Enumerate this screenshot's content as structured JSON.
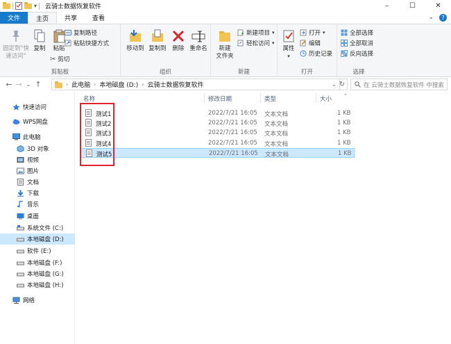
{
  "window": {
    "title": "云骑士数据恢复软件",
    "controls": [
      "–",
      "☐",
      "✕"
    ]
  },
  "tabs": [
    {
      "label": "文件"
    },
    {
      "label": "主页"
    },
    {
      "label": "共享"
    },
    {
      "label": "查看"
    }
  ],
  "ribbon": {
    "clipboard": {
      "label": "剪贴板",
      "pin": "固定到\"快\n速访问\"",
      "copy": "复制",
      "paste": "粘贴",
      "copy_path": "复制路径",
      "paste_shortcut": "粘贴快捷方式",
      "cut": "剪切"
    },
    "organize": {
      "label": "组织",
      "move_to": "移动到",
      "copy_to": "复制到",
      "delete": "删除",
      "rename": "重命名"
    },
    "new": {
      "label": "新建",
      "new_folder": "新建\n文件夹",
      "new_item": "新建项目",
      "easy_access": "轻松访问"
    },
    "open": {
      "label": "打开",
      "properties": "属性",
      "open": "打开",
      "edit": "编辑",
      "history": "历史记录"
    },
    "select": {
      "label": "选择",
      "select_all": "全部选择",
      "select_none": "全部取消",
      "invert": "反向选择"
    }
  },
  "address": {
    "crumbs": [
      "此电脑",
      "本地磁盘 (D:)",
      "云骑士数据恢复软件"
    ],
    "search_placeholder": "在 云骑士数据恢复软件 中搜索"
  },
  "nav": [
    {
      "label": "快速访问",
      "icon": "star-icon"
    },
    {
      "label": "WPS网盘",
      "icon": "cloud-icon"
    },
    {
      "label": "此电脑",
      "icon": "computer-icon"
    },
    {
      "label": "3D 对象",
      "icon": "cube-icon"
    },
    {
      "label": "视频",
      "icon": "video-icon"
    },
    {
      "label": "图片",
      "icon": "picture-icon"
    },
    {
      "label": "文档",
      "icon": "document-icon"
    },
    {
      "label": "下载",
      "icon": "download-icon"
    },
    {
      "label": "音乐",
      "icon": "music-icon"
    },
    {
      "label": "桌面",
      "icon": "desktop-icon"
    },
    {
      "label": "系统文件 (C:)",
      "icon": "drive-icon"
    },
    {
      "label": "本地磁盘 (D:)",
      "icon": "drive-icon",
      "selected": true
    },
    {
      "label": "软件 (E:)",
      "icon": "drive-icon"
    },
    {
      "label": "本地磁盘 (F:)",
      "icon": "drive-icon"
    },
    {
      "label": "本地磁盘 (G:)",
      "icon": "drive-icon"
    },
    {
      "label": "本地磁盘 (H:)",
      "icon": "drive-icon"
    },
    {
      "label": "网络",
      "icon": "network-icon"
    }
  ],
  "columns": {
    "name": "名称",
    "date": "修改日期",
    "type": "类型",
    "size": "大小"
  },
  "files": [
    {
      "name": "测试1",
      "date": "2022/7/21 16:05",
      "type": "文本文档",
      "size": "1 KB"
    },
    {
      "name": "测试2",
      "date": "2022/7/21 16:05",
      "type": "文本文档",
      "size": "1 KB"
    },
    {
      "name": "测试3",
      "date": "2022/7/21 16:05",
      "type": "文本文档",
      "size": "1 KB"
    },
    {
      "name": "测试4",
      "date": "2022/7/21 16:05",
      "type": "文本文档",
      "size": "1 KB"
    },
    {
      "name": "测试5",
      "date": "2022/7/21 16:05",
      "type": "文本文档",
      "size": "1 KB",
      "selected": true
    }
  ],
  "colors": {
    "accent": "#1979ca",
    "selection": "#cce8ff",
    "highlight_box": "#e0232c"
  }
}
